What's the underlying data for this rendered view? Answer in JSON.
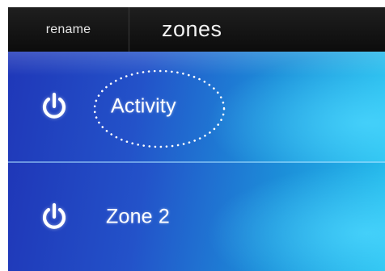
{
  "header": {
    "rename_label": "rename",
    "title": "zones"
  },
  "zones": [
    {
      "name": "Activity",
      "power_icon": "power-icon",
      "highlighted": true
    },
    {
      "name": "Zone 2",
      "power_icon": "power-icon",
      "highlighted": false
    }
  ],
  "colors": {
    "header_bg": "#111111",
    "row_gradient_start": "#1f37b8",
    "row_gradient_end": "#27c1ee",
    "text": "#ffffff"
  }
}
